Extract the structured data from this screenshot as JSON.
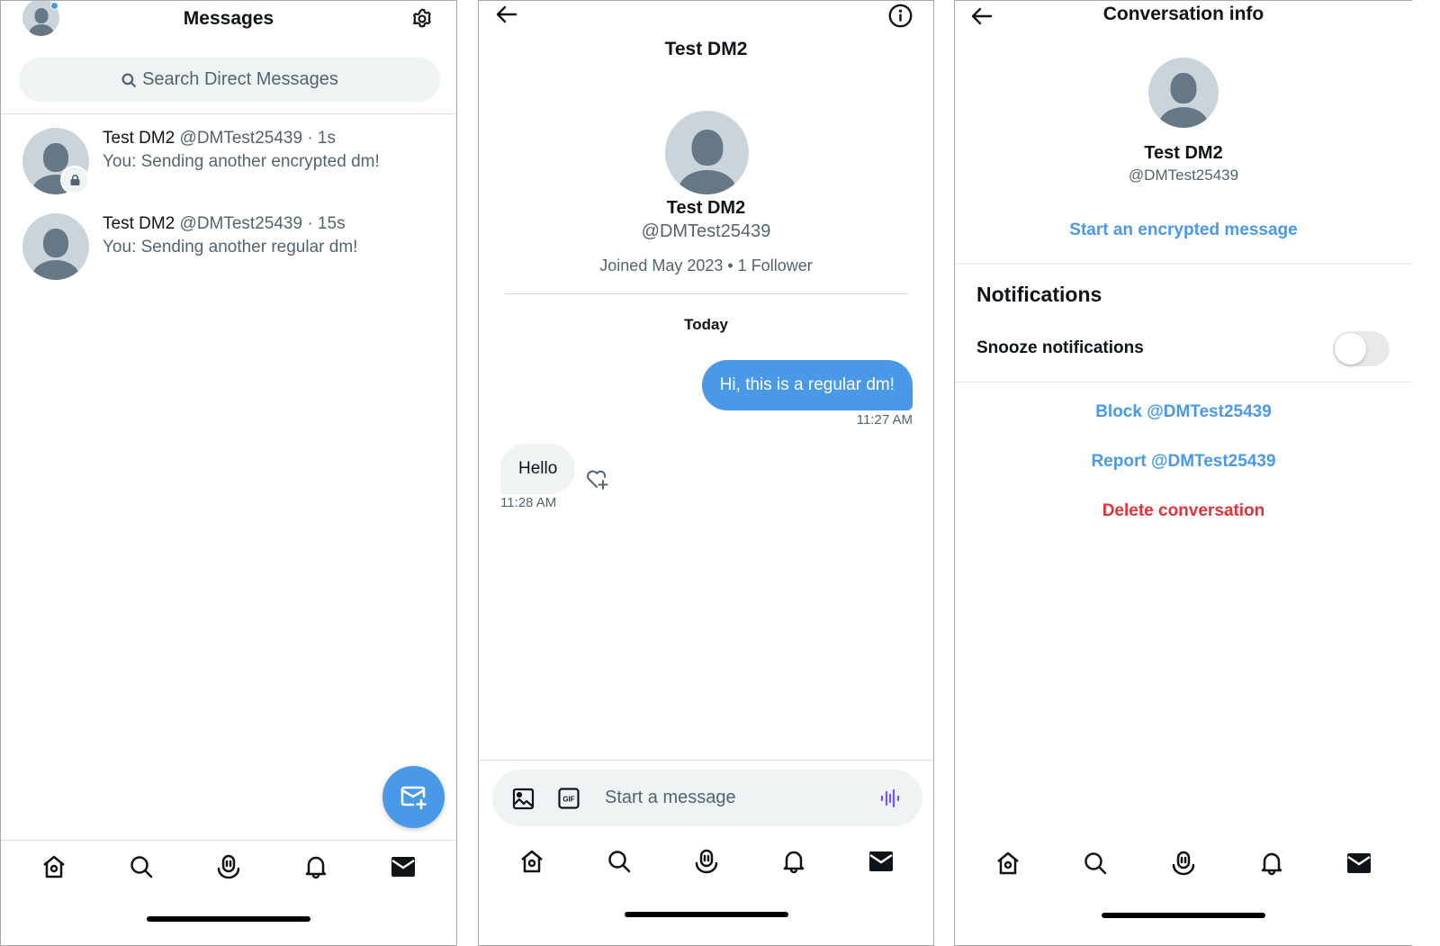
{
  "inbox": {
    "title": "Messages",
    "search_placeholder": "Search Direct Messages",
    "conversations": [
      {
        "name": "Test DM2",
        "meta": "@DMTest25439 · 1s",
        "preview": "You: Sending another encrypted dm!",
        "encrypted": true
      },
      {
        "name": "Test DM2",
        "meta": "@DMTest25439 · 15s",
        "preview": "You: Sending another regular dm!",
        "encrypted": false
      }
    ],
    "icons": {
      "avatar": "profile-avatar-with-unread-dot",
      "settings": "gear-icon",
      "new_message": "envelope-plus-icon"
    }
  },
  "chat": {
    "title": "Test DM2",
    "profile": {
      "name": "Test DM2",
      "handle": "@DMTest25439",
      "joined": "Joined May 2023 • 1 Follower"
    },
    "date_separator": "Today",
    "messages": [
      {
        "direction": "outgoing",
        "text": "Hi, this is a regular dm!",
        "time": "11:27 AM"
      },
      {
        "direction": "incoming",
        "text": "Hello",
        "time": "11:28 AM"
      }
    ],
    "composer_placeholder": "Start a message",
    "composer_icons": [
      "image-icon",
      "gif-icon",
      "voice-waveform-icon"
    ]
  },
  "info": {
    "title": "Conversation info",
    "profile": {
      "name": "Test DM2",
      "handle": "@DMTest25439"
    },
    "encrypted_action": "Start an encrypted message",
    "notifications_heading": "Notifications",
    "snooze_label": "Snooze notifications",
    "snooze_enabled": false,
    "block_label": "Block @DMTest25439",
    "report_label": "Report @DMTest25439",
    "delete_label": "Delete conversation"
  },
  "tabbar": {
    "items": [
      "home",
      "search",
      "spaces",
      "notifications",
      "messages"
    ],
    "active": "messages"
  },
  "colors": {
    "accent": "#4a99e9",
    "danger": "#e0343a",
    "text_secondary": "#536471",
    "bubble_incoming": "#eff3f4",
    "avatar_bg": "#cbd3db",
    "avatar_fg": "#667786",
    "voice_icon": "#7856ff"
  }
}
